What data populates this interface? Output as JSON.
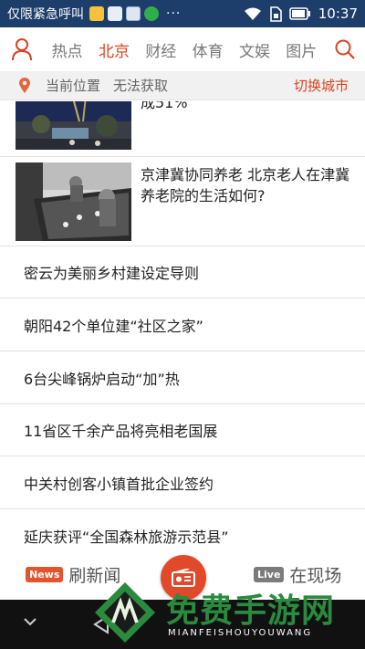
{
  "status_bar": {
    "carrier": "仅限紧急呼叫",
    "more": "···",
    "time": "10:37"
  },
  "nav": {
    "tabs": [
      "热点",
      "北京",
      "财经",
      "体育",
      "文娱",
      "图片"
    ],
    "active_tab": "北京"
  },
  "location": {
    "current_label": "当前位置",
    "status": "无法获取",
    "switch_label": "切换城市"
  },
  "feed": {
    "image_items": [
      {
        "title": "成51%"
      },
      {
        "title": "京津冀协同养老 北京老人在津冀养老院的生活如何?"
      }
    ],
    "text_items": [
      "密云为美丽乡村建设定导则",
      "朝阳42个单位建“社区之家”",
      "6台尖峰锅炉启动“加”热",
      "11省区千余产品将亮相老国展",
      "中关村创客小镇首批企业签约",
      "延庆获评“全国森林旅游示范县”"
    ]
  },
  "bottom_bar": {
    "news_badge": "News",
    "news_label": "刷新闻",
    "live_badge": "Live",
    "live_label": "在现场"
  },
  "watermark": {
    "main": "免费手游网",
    "sub": "MIANFEISHOUYOUWANG"
  },
  "colors": {
    "accent": "#d9431e",
    "status_bar": "#1d3d6b",
    "radio_button": "#e04a2b",
    "watermark_green": "#2a8a3e"
  }
}
